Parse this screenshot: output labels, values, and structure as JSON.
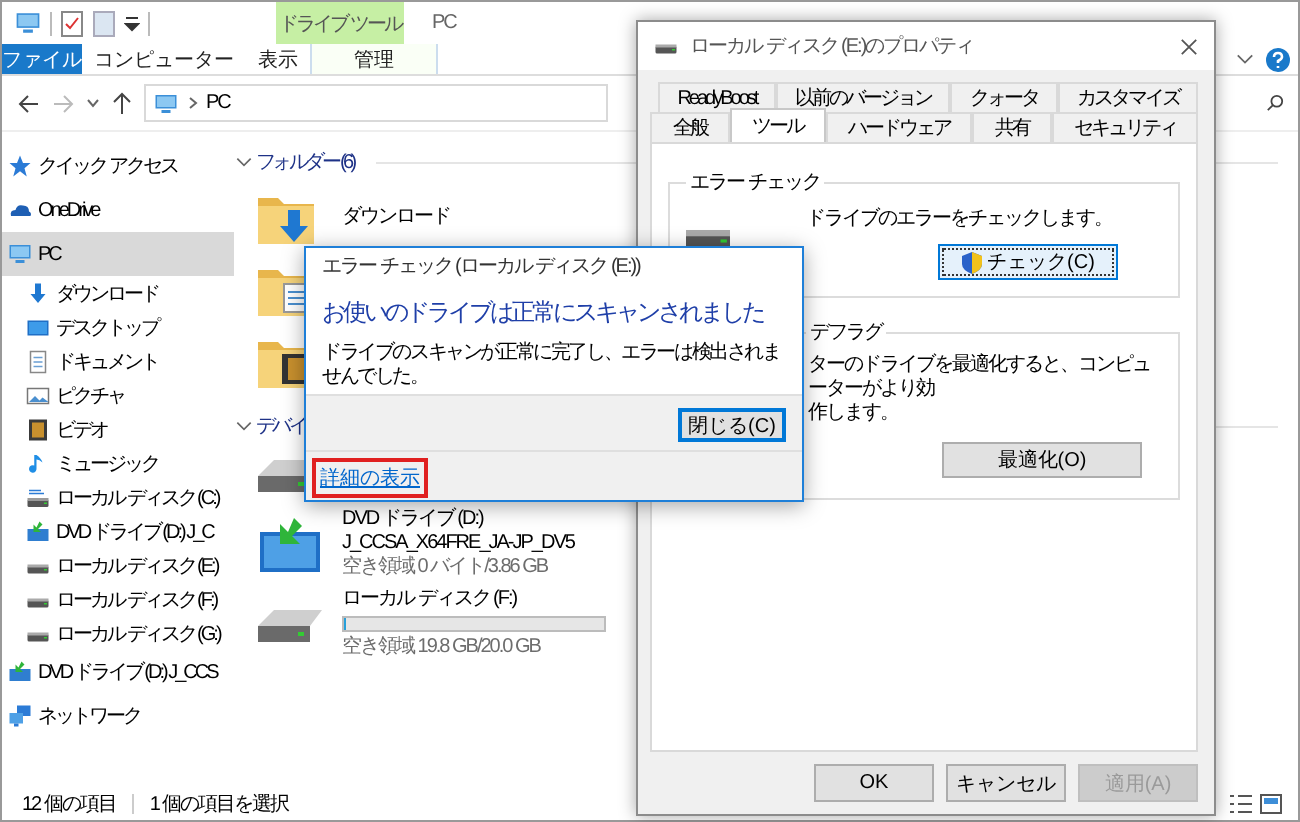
{
  "explorer": {
    "context_tab": "ドライブ ツール",
    "title": "PC",
    "ribbon_tabs": [
      {
        "label": "ファイル",
        "kind": "file"
      },
      {
        "label": "コンピューター",
        "kind": "tab"
      },
      {
        "label": "表示",
        "kind": "tab"
      },
      {
        "label": "管理",
        "kind": "context"
      }
    ],
    "address": "PC",
    "sidebar": [
      {
        "label": "クイック アクセス",
        "kind": "star",
        "selected": false
      },
      {
        "label": "OneDrive",
        "kind": "cloud",
        "selected": false
      },
      {
        "label": "PC",
        "kind": "pc",
        "selected": true,
        "children": [
          {
            "label": "ダウンロード",
            "kind": "download",
            "selected": false
          },
          {
            "label": "デスクトップ",
            "kind": "desktop",
            "selected": false
          },
          {
            "label": "ドキュメント",
            "kind": "document",
            "selected": false
          },
          {
            "label": "ピクチャ",
            "kind": "picture",
            "selected": false
          },
          {
            "label": "ビデオ",
            "kind": "video",
            "selected": false
          },
          {
            "label": "ミュージック",
            "kind": "music",
            "selected": false
          },
          {
            "label": "ローカル ディスク (C:)",
            "kind": "sysdrive",
            "selected": false
          },
          {
            "label": "DVD ドライブ (D:) J_C",
            "kind": "dvd",
            "selected": false
          },
          {
            "label": "ローカル ディスク (E:)",
            "kind": "drive",
            "selected": false
          },
          {
            "label": "ローカル ディスク (F:)",
            "kind": "drive",
            "selected": false
          },
          {
            "label": "ローカル ディスク (G:)",
            "kind": "drive",
            "selected": false
          }
        ]
      },
      {
        "label": "DVD ドライブ (D:) J_CCS",
        "kind": "dvd",
        "selected": false
      },
      {
        "label": "ネットワーク",
        "kind": "network",
        "selected": false
      }
    ],
    "sections": [
      {
        "title": "フォルダー (6)",
        "expanded": true,
        "items": [
          {
            "kind": "download",
            "name": "ダウンロード"
          },
          {
            "kind": "document"
          },
          {
            "kind": "video"
          }
        ]
      },
      {
        "title": "デバイ",
        "expanded": true,
        "items": [
          {
            "kind": "drive"
          },
          {
            "kind": "dvd",
            "name": "DVD ドライブ (D:)",
            "label": "J_CCSA_X64FRE_JA-JP_DV5",
            "free": "空き領域 0 バイト/3.86 GB"
          },
          {
            "kind": "drive",
            "name": "ローカル ディスク (F:)",
            "level": 0.01,
            "free": "空き領域 19.8 GB/20.0 GB"
          }
        ]
      }
    ],
    "status_bar": [
      "12 個の項目",
      "1 個の項目を選択"
    ]
  },
  "properties": {
    "title": "ローカル ディスク (E:)のプロパティ",
    "tab_rows": [
      [
        {
          "label": "ReadyBoost",
          "selected": false
        },
        {
          "label": "以前のバージョン",
          "selected": false
        },
        {
          "label": "クォータ",
          "selected": false
        },
        {
          "label": "カスタマイズ",
          "selected": false
        }
      ],
      [
        {
          "label": "全般",
          "selected": false
        },
        {
          "label": "ツール",
          "selected": true
        },
        {
          "label": "ハードウェア",
          "selected": false
        },
        {
          "label": "共有",
          "selected": false
        },
        {
          "label": "セキュリティ",
          "selected": false
        }
      ]
    ],
    "error_check": {
      "title": "エラー チェック",
      "text": "ドライブのエラーをチェックします。",
      "button": "チェック(C)"
    },
    "defrag": {
      "title": "デフラグ",
      "text_lines": [
        "ターのドライブを最適化すると、コンピューターがより効",
        "作します。"
      ],
      "button": "最適化(O)"
    },
    "buttons": [
      {
        "label": "OK",
        "disabled": false
      },
      {
        "label": "キャンセル",
        "disabled": false
      },
      {
        "label": "適用(A)",
        "disabled": true
      }
    ]
  },
  "error_dialog": {
    "title": "エラー チェック (ローカル ディスク (E:))",
    "heading": "お使いのドライブは正常にスキャンされました",
    "message": "ドライブのスキャンが正常に完了し、エラーは検出されませんでした。",
    "close_button": "閉じる(C)",
    "details_link": "詳細の表示",
    "highlighted": true
  }
}
